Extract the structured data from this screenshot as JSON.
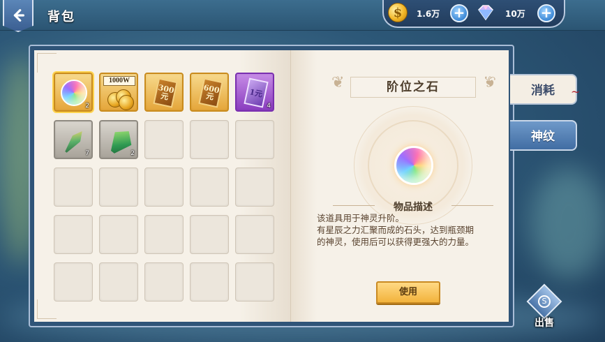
{
  "header": {
    "title": "背包",
    "back_icon": "back-arrow-icon"
  },
  "currency": {
    "gold": {
      "icon": "gold-coin-icon",
      "value": "1.6万",
      "coin_symbol": "$"
    },
    "diamond": {
      "icon": "diamond-icon",
      "value": "10万"
    },
    "plus_label": "+"
  },
  "inventory": {
    "items": [
      {
        "type": "rainbow-orb",
        "qty": "2",
        "frame": "gold",
        "selected": true
      },
      {
        "type": "gold-coins",
        "label": "1000W",
        "frame": "gold"
      },
      {
        "type": "card",
        "label": "300元",
        "frame": "gold"
      },
      {
        "type": "card",
        "label": "600元",
        "frame": "gold"
      },
      {
        "type": "purple-card",
        "label": "1元",
        "qty": "4",
        "frame": "purple"
      },
      {
        "type": "dagger-crystal",
        "qty": "7",
        "frame": "grey"
      },
      {
        "type": "green-crystal",
        "qty": "2",
        "frame": "grey"
      }
    ],
    "grid_columns": 5,
    "grid_rows": 5
  },
  "detail": {
    "item_name": "阶位之石",
    "desc_heading": "物品描述",
    "desc_line1": "该道具用于神灵升阶。",
    "desc_line2": "有星辰之力汇聚而成的石头，达到瓶颈期的神灵，使用后可以获得更强大的力量。",
    "use_button": "使用"
  },
  "tabs": [
    {
      "label": "消耗",
      "active": true
    },
    {
      "label": "神纹",
      "active": false
    }
  ],
  "sell": {
    "label": "出售",
    "icon": "sell-coin-icon",
    "symbol": "S"
  },
  "colors": {
    "accent_gold": "#f2b33c",
    "panel_blue": "#2f5478",
    "paper": "#f4eee4",
    "purple_frame": "#8a3dbf"
  }
}
